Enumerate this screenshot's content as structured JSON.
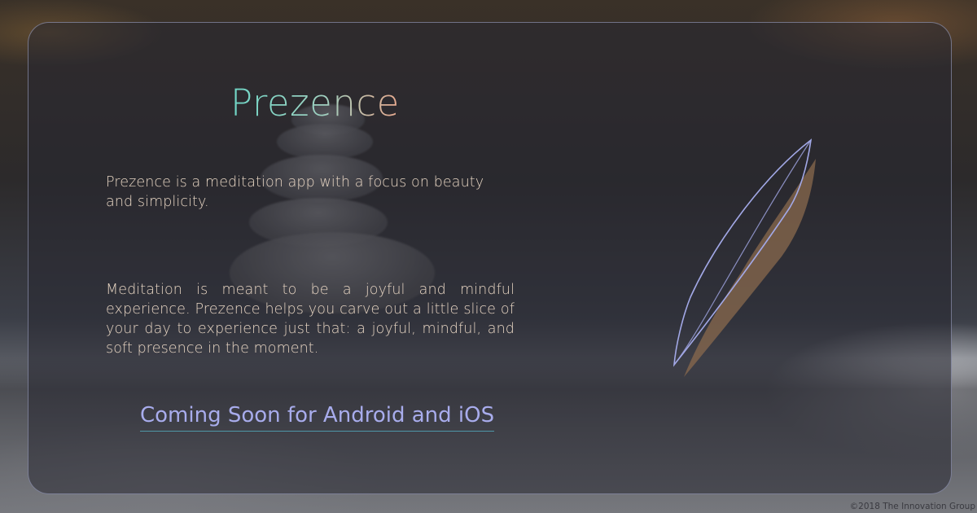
{
  "app": {
    "title": "Prezence"
  },
  "content": {
    "intro": "Prezence is a meditation app with a focus on beauty and simplicity.",
    "description": "Meditation is meant to be a joyful and mindful experience. Prezence helps you carve out a little slice of your day to experience just that: a joyful, mindful, and soft presence in the moment.",
    "cta": "Coming Soon for Android and iOS"
  },
  "footer": {
    "copyright": "©2018 The Innovation Group"
  },
  "icons": {
    "logo": "leaf-logo-icon"
  },
  "colors": {
    "title_gradient_start": "#6fd6c6",
    "title_gradient_end": "#e9a98e",
    "body_text": "#e6d4c2",
    "cta_text": "#a8acec",
    "cta_underline": "#4f97a8",
    "card_border": "#aaafd2",
    "logo_stroke": "#a2a8e6",
    "logo_fill": "#8a6a4e"
  }
}
